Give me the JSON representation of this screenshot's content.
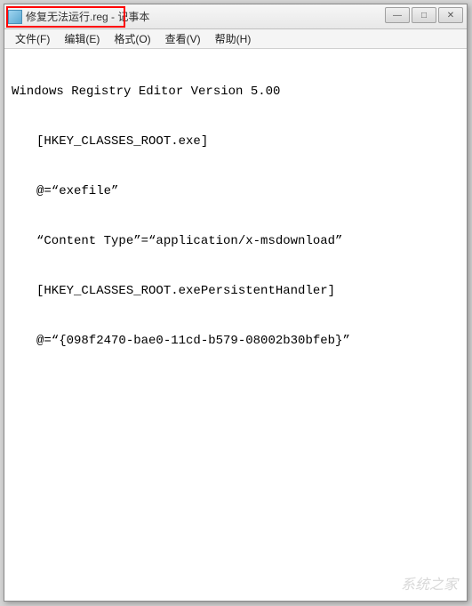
{
  "window": {
    "title_filename": "修复无法运行.reg",
    "title_separator": " - ",
    "title_app": "记事本"
  },
  "controls": {
    "minimize": "—",
    "maximize": "□",
    "close": "✕"
  },
  "menu": {
    "file": "文件(F)",
    "edit": "编辑(E)",
    "format": "格式(O)",
    "view": "查看(V)",
    "help": "帮助(H)"
  },
  "content": {
    "line1": "Windows Registry Editor Version 5.00",
    "line2": "[HKEY_CLASSES_ROOT.exe]",
    "line3": "@=“exefile”",
    "line4": "“Content Type”=“application/x-msdownload”",
    "line5": "[HKEY_CLASSES_ROOT.exePersistentHandler]",
    "line6": "@=“{098f2470-bae0-11cd-b579-08002b30bfeb}”"
  },
  "watermark": "系统之家"
}
